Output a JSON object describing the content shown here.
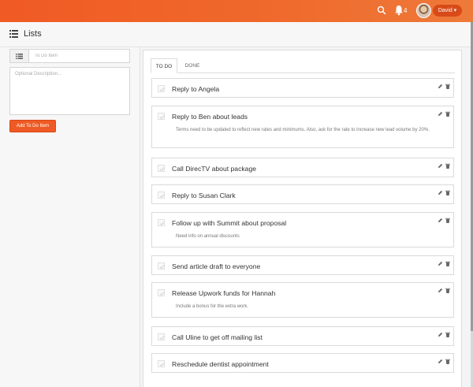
{
  "topbar": {
    "search_icon": "search-icon",
    "notifications_icon": "bell-icon",
    "notifications_count": "4",
    "user_label": "David ▾",
    "accent_color": "#f05a24"
  },
  "header": {
    "title": "Lists",
    "icon": "list-icon"
  },
  "form": {
    "todo_placeholder": "To Do Item",
    "todo_value": "",
    "description_placeholder": "Optional Description...",
    "description_value": "",
    "add_button": "Add To Do Item"
  },
  "tabs": [
    {
      "label": "TO DO",
      "active": true
    },
    {
      "label": "DONE",
      "active": false
    }
  ],
  "items": [
    {
      "title": "Reply to Angela",
      "description": ""
    },
    {
      "title": "Reply to Ben about leads",
      "description": "Terms need to be updated to reflect new rates and minimums. Also, ask for the rate to increase new lead volume by 20%."
    },
    {
      "title": "Call DirecTV about package",
      "description": ""
    },
    {
      "title": "Reply to Susan Clark",
      "description": ""
    },
    {
      "title": "Follow up with Summit about proposal",
      "description": "Need info on annual discounts"
    },
    {
      "title": "Send article draft to everyone",
      "description": ""
    },
    {
      "title": "Release Upwork funds for Hannah",
      "description": "Include a bonus for the extra work."
    },
    {
      "title": "Call Uline to get off mailing list",
      "description": ""
    },
    {
      "title": "Reschedule dentist appointment",
      "description": ""
    }
  ]
}
